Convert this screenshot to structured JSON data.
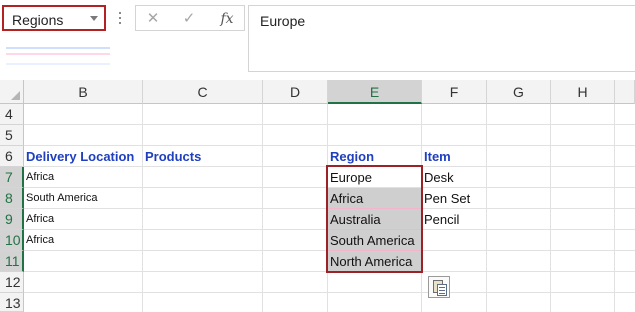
{
  "name_box": {
    "value": "Regions"
  },
  "formula_bar": {
    "content": "Europe",
    "cancel_glyph": "✕",
    "enter_glyph": "✓",
    "fx_label": "fx"
  },
  "columns": [
    "B",
    "C",
    "D",
    "E",
    "F",
    "G",
    "H"
  ],
  "selected_column": "E",
  "rows": [
    "4",
    "5",
    "6",
    "7",
    "8",
    "9",
    "10",
    "11",
    "12",
    "13"
  ],
  "selected_rows": [
    "7",
    "8",
    "9",
    "10",
    "11"
  ],
  "sheet": {
    "B6": "Delivery Location",
    "C6": "Products",
    "E6": "Region",
    "F6": "Item",
    "B7": "Africa",
    "B8": "South America",
    "B9": "Africa",
    "B10": "Africa",
    "E7": "Europe",
    "E8": "Africa",
    "E9": "Australia",
    "E10": "South America",
    "E11": "North America",
    "F7": "Desk",
    "F8": "Pen Set",
    "F9": "Pencil"
  },
  "icons": {
    "paste_options": "paste-options-icon"
  },
  "colors": {
    "header_text": "#1f3fbf",
    "selection_border": "#9b2226",
    "selected_header": "#217346",
    "selected_fill": "#cfcfcf"
  }
}
